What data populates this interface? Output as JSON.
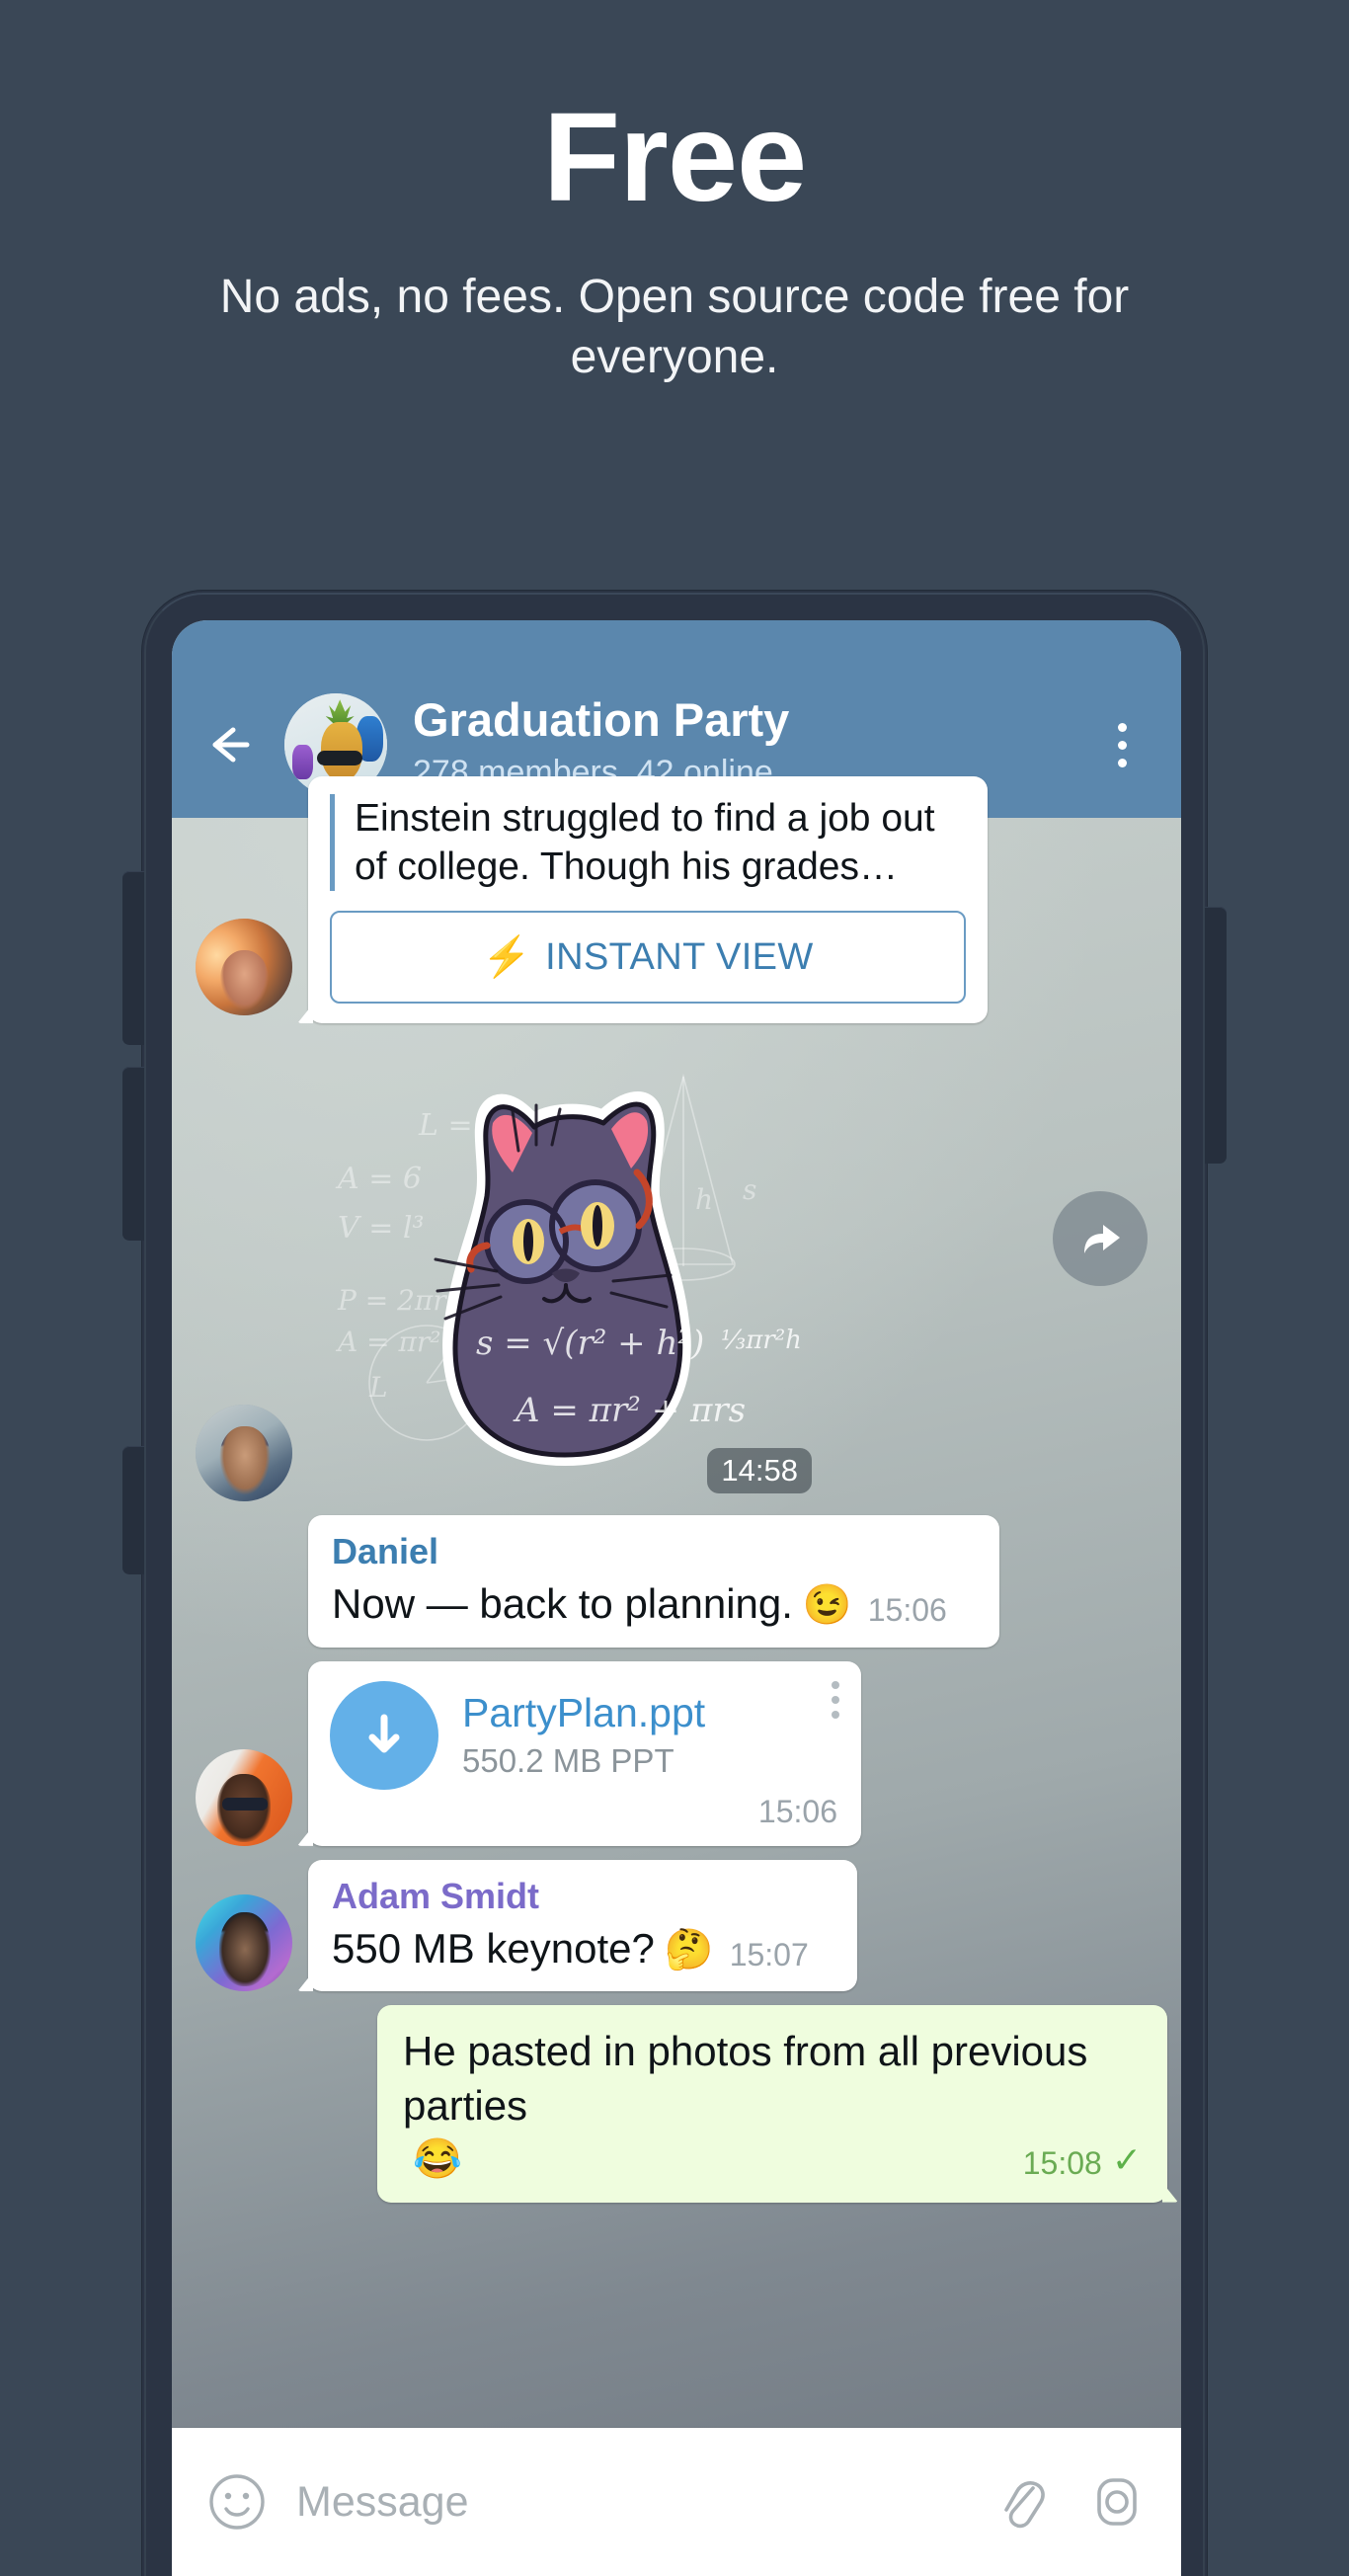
{
  "promo": {
    "title": "Free",
    "subtitle": "No ads, no fees. Open source code free for everyone."
  },
  "colors": {
    "page_background": "#3a4756",
    "phone_frame": "#2b3444",
    "header_blue": "#5b87ad",
    "accent_link": "#3c7eb0",
    "outgoing_bubble": "#effdde",
    "incoming_bubble": "#ffffff",
    "sender_blue": "#3c7eb0",
    "sender_purple": "#7b6bc9",
    "download_circle": "#63b0e8",
    "tick_green": "#5db14a"
  },
  "chat_header": {
    "back_icon": "back-arrow-icon",
    "avatar": "pineapple-sunglasses-avatar",
    "title": "Graduation Party",
    "subtitle": "278 members, 42 online",
    "menu_icon": "kebab-menu-icon"
  },
  "messages": [
    {
      "type": "link_preview",
      "avatar": "woman-sunset-avatar",
      "preview_text": "Einstein struggled to find a job out of college. Though his grades…",
      "button_label": "INSTANT VIEW",
      "button_icon": "lightning-bolt-icon",
      "forward_icon": "forward-arrow-icon"
    },
    {
      "type": "sticker",
      "avatar": "hoodie-person-avatar",
      "sticker_name": "math-cat-sticker",
      "time": "14:58",
      "formulas": [
        "L = πr",
        "A = 6",
        "V = l³",
        "P = 2πr",
        "A = πr²",
        "θ",
        "h",
        "s",
        "L",
        "s = √(r² + h²)",
        "A = πr² + πrs",
        "⅓πr²h"
      ]
    },
    {
      "type": "text",
      "avatar": null,
      "sender": "Daniel",
      "sender_color": "blue",
      "text": "Now — back to planning.",
      "emoji": "😉",
      "time": "15:06"
    },
    {
      "type": "file",
      "avatar": "sunglasses-man-avatar",
      "file_name": "PartyPlan.ppt",
      "file_meta": "550.2 MB PPT",
      "download_icon": "download-arrow-icon",
      "menu_icon": "kebab-menu-icon",
      "time": "15:06"
    },
    {
      "type": "text",
      "avatar": "beanie-man-avatar",
      "sender": "Adam Smidt",
      "sender_color": "purple",
      "text": "550 MB keynote?",
      "emoji": "🤔",
      "time": "15:07"
    },
    {
      "type": "text_out",
      "sender": null,
      "text": "He pasted in photos from all previous parties",
      "emoji": "😂",
      "time": "15:08",
      "status_icon": "single-check-icon"
    }
  ],
  "input_bar": {
    "emoji_icon": "smiley-icon",
    "placeholder": "Message",
    "attach_icon": "paperclip-icon",
    "camera_icon": "camera-icon"
  }
}
